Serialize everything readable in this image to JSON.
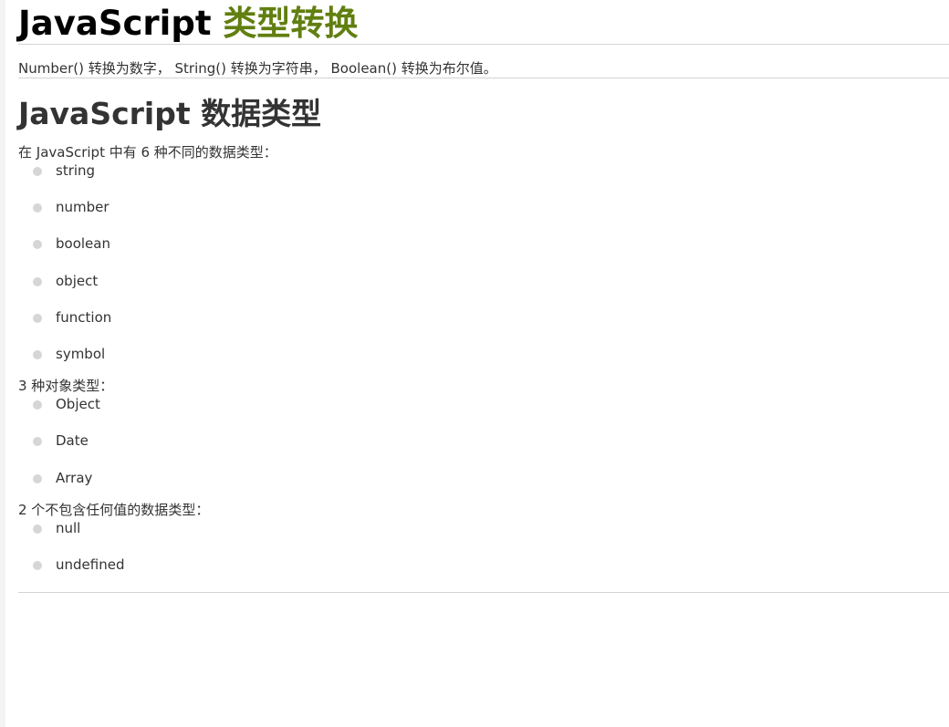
{
  "header": {
    "title_prefix": "JavaScript",
    "title_highlight": "类型转换"
  },
  "intro": "Number() 转换为数字， String() 转换为字符串， Boolean() 转换为布尔值。",
  "data_types_section": {
    "title": "JavaScript 数据类型",
    "six_types_text": "在 JavaScript 中有 6 种不同的数据类型：",
    "six_types": [
      "string",
      "number",
      "boolean",
      "object",
      "function",
      "symbol"
    ],
    "object_types_text": "3 种对象类型：",
    "object_types": [
      "Object",
      "Date",
      "Array"
    ],
    "valueless_types_text": "2 个不包含任何值的数据类型：",
    "valueless_types": [
      "null",
      "undefined"
    ]
  },
  "colors": {
    "title_highlight": "#617f10",
    "bullet": "#d6d6d6",
    "rule": "#d4d4d4"
  }
}
